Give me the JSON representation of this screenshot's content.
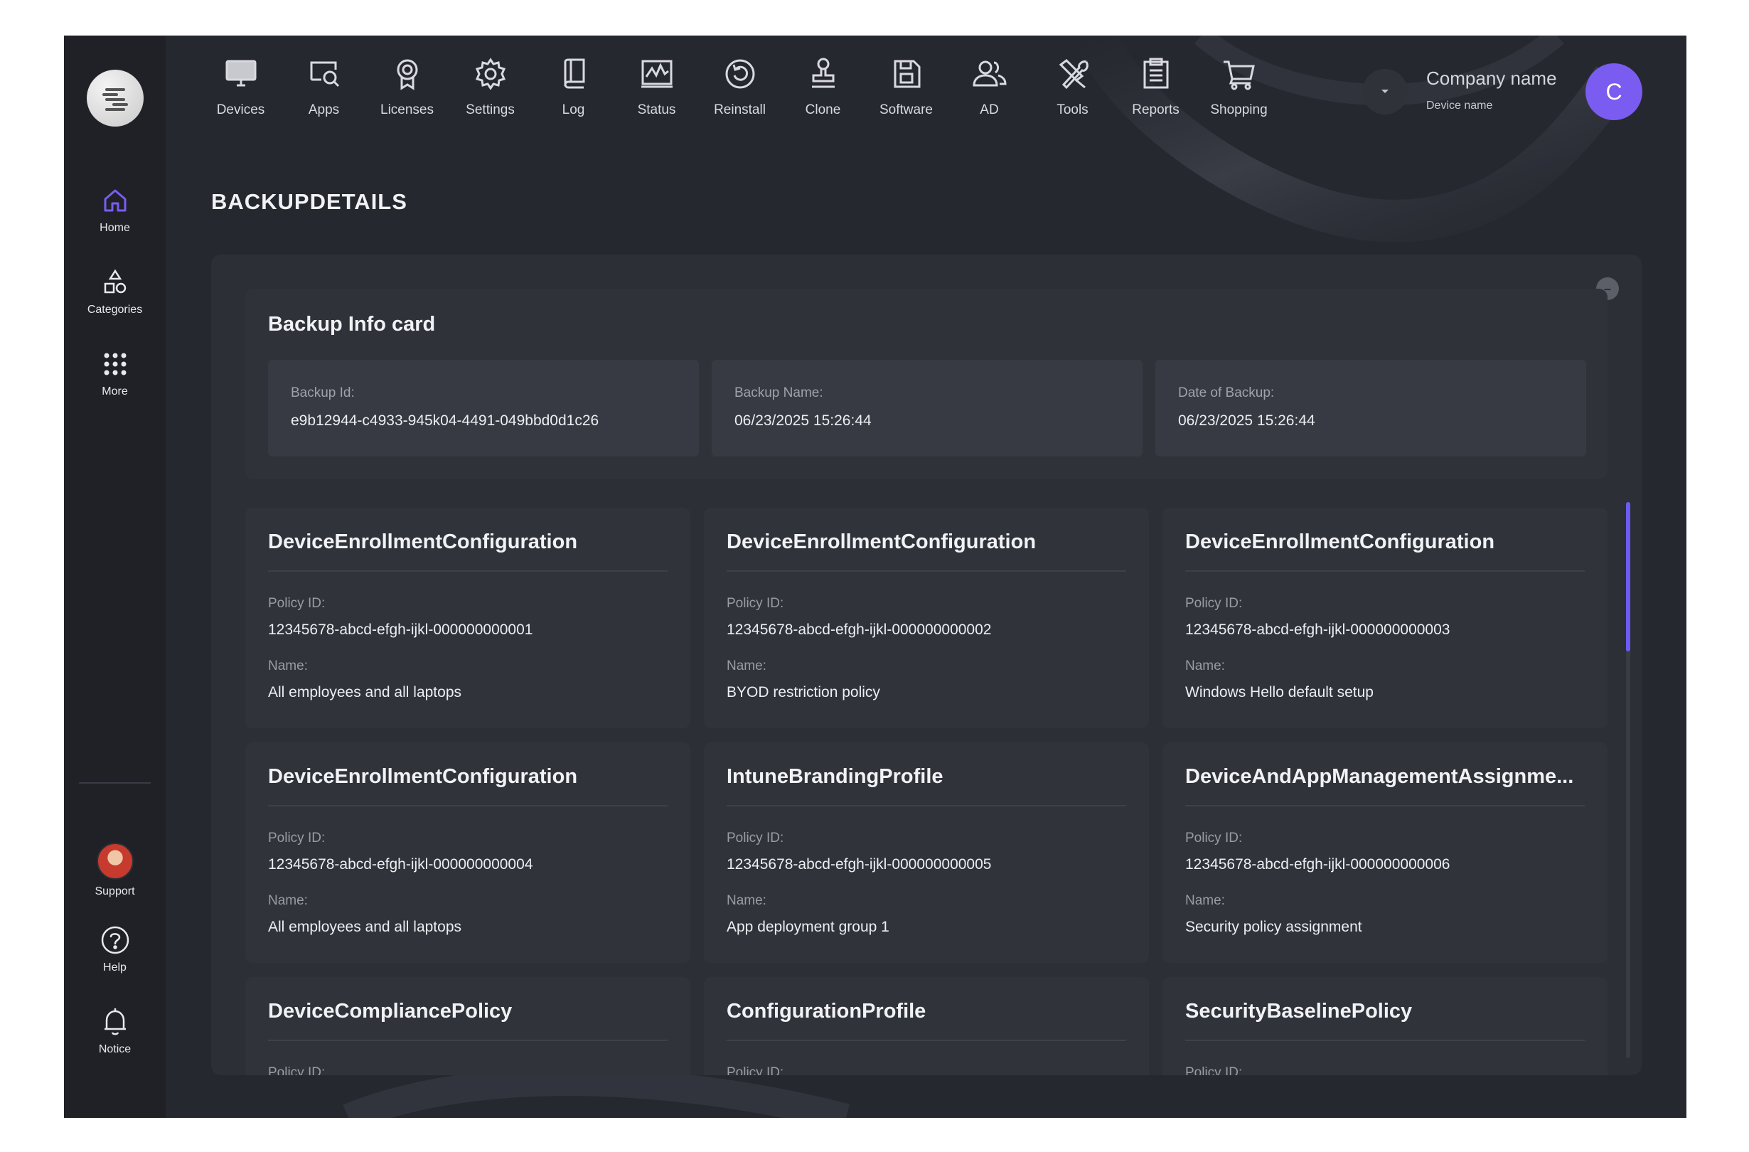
{
  "sidebar": {
    "items": [
      {
        "label": "Home",
        "icon": "home-icon"
      },
      {
        "label": "Categories",
        "icon": "categories-icon"
      },
      {
        "label": "More",
        "icon": "grid-dots-icon"
      }
    ],
    "bottom": [
      {
        "label": "Support",
        "icon": "support-avatar"
      },
      {
        "label": "Help",
        "icon": "help-icon"
      },
      {
        "label": "Notice",
        "icon": "bell-icon"
      }
    ],
    "accent": "#7a5cf0"
  },
  "topnav": {
    "items": [
      {
        "label": "Devices",
        "icon": "monitor-icon"
      },
      {
        "label": "Apps",
        "icon": "apps-search-icon"
      },
      {
        "label": "Licenses",
        "icon": "license-badge-icon"
      },
      {
        "label": "Settings",
        "icon": "gear-icon"
      },
      {
        "label": "Log",
        "icon": "book-icon"
      },
      {
        "label": "Status",
        "icon": "status-chart-icon"
      },
      {
        "label": "Reinstall",
        "icon": "reinstall-icon"
      },
      {
        "label": "Clone",
        "icon": "stamp-icon"
      },
      {
        "label": "Software",
        "icon": "save-disk-icon"
      },
      {
        "label": "AD",
        "icon": "users-icon"
      },
      {
        "label": "Tools",
        "icon": "tools-icon"
      },
      {
        "label": "Reports",
        "icon": "clipboard-icon"
      },
      {
        "label": "Shopping",
        "icon": "cart-icon"
      }
    ]
  },
  "header": {
    "company_name": "Company name",
    "device_name": "Device name",
    "user_initial": "C"
  },
  "page": {
    "title": "BACKUPDETAILS"
  },
  "backup_info": {
    "title": "Backup Info card",
    "fields": [
      {
        "label": "Backup Id:",
        "value": "e9b12944-c4933-945k04-4491-049bbd0d1c26"
      },
      {
        "label": "Backup Name:",
        "value": "06/23/2025 15:26:44"
      },
      {
        "label": "Date of Backup:",
        "value": "06/23/2025 15:26:44"
      }
    ]
  },
  "policies": [
    {
      "type": "DeviceEnrollmentConfiguration",
      "id_label": "Policy ID:",
      "id": "12345678-abcd-efgh-ijkl-000000000001",
      "name_label": "Name:",
      "name": "All employees and all laptops"
    },
    {
      "type": "DeviceEnrollmentConfiguration",
      "id_label": "Policy ID:",
      "id": "12345678-abcd-efgh-ijkl-000000000002",
      "name_label": "Name:",
      "name": "BYOD restriction policy"
    },
    {
      "type": "DeviceEnrollmentConfiguration",
      "id_label": "Policy ID:",
      "id": "12345678-abcd-efgh-ijkl-000000000003",
      "name_label": "Name:",
      "name": "Windows Hello default setup"
    },
    {
      "type": "DeviceEnrollmentConfiguration",
      "id_label": "Policy ID:",
      "id": "12345678-abcd-efgh-ijkl-000000000004",
      "name_label": "Name:",
      "name": "All employees and all laptops"
    },
    {
      "type": "IntuneBrandingProfile",
      "id_label": "Policy ID:",
      "id": "12345678-abcd-efgh-ijkl-000000000005",
      "name_label": "Name:",
      "name": "App deployment group 1"
    },
    {
      "type": "DeviceAndAppManagementAssignme...",
      "id_label": "Policy ID:",
      "id": "12345678-abcd-efgh-ijkl-000000000006",
      "name_label": "Name:",
      "name": "Security policy assignment"
    },
    {
      "type": "DeviceCompliancePolicy",
      "id_label": "Policy ID:",
      "id": "",
      "name_label": "",
      "name": ""
    },
    {
      "type": "ConfigurationProfile",
      "id_label": "Policy ID:",
      "id": "",
      "name_label": "",
      "name": ""
    },
    {
      "type": "SecurityBaselinePolicy",
      "id_label": "Policy ID:",
      "id": "",
      "name_label": "",
      "name": ""
    }
  ]
}
